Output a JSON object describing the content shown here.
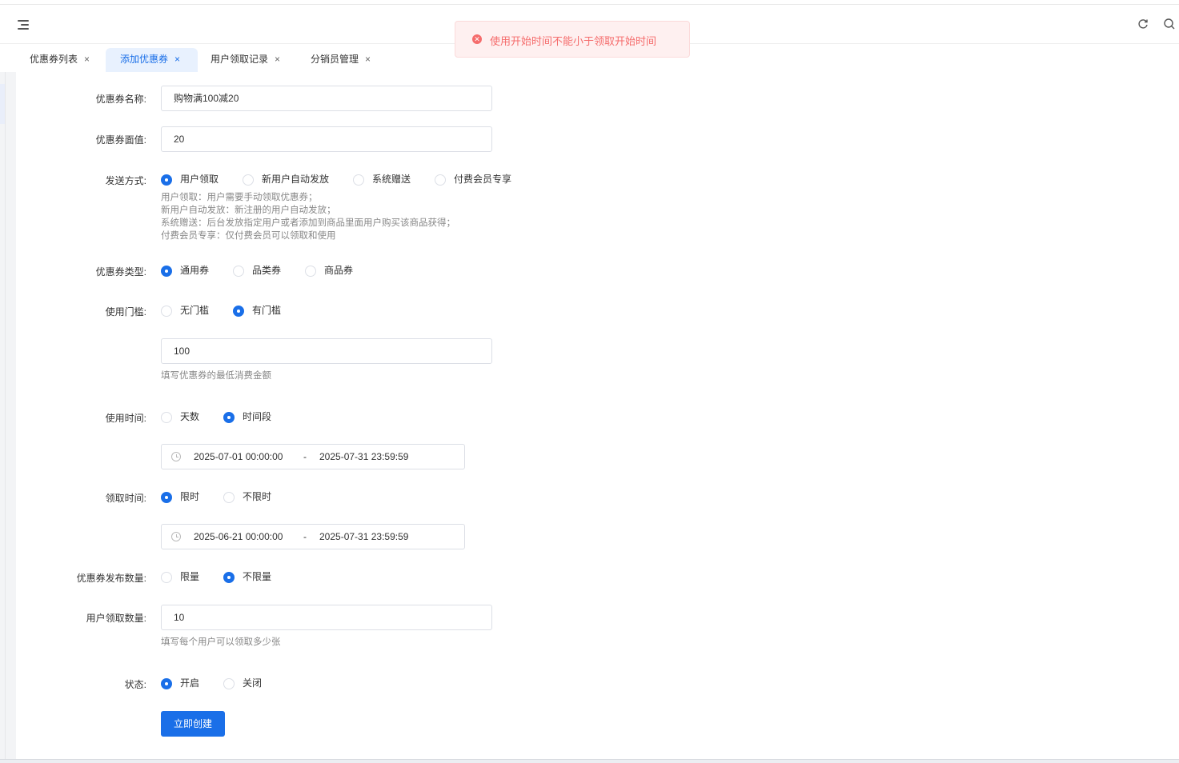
{
  "toast": {
    "message": "使用开始时间不能小于领取开始时间"
  },
  "tabs": [
    {
      "label": "优惠券列表"
    },
    {
      "label": "添加优惠券"
    },
    {
      "label": "用户领取记录"
    },
    {
      "label": "分销员管理"
    }
  ],
  "tab_close": "×",
  "form": {
    "name": {
      "label": "优惠券名称:",
      "value": "购物满100减20"
    },
    "value": {
      "label": "优惠券面值:",
      "value": "20"
    },
    "send": {
      "label": "发送方式:",
      "options": [
        "用户领取",
        "新用户自动发放",
        "系统赠送",
        "付费会员专享"
      ],
      "selected": "用户领取",
      "hints": [
        "用户领取：用户需要手动领取优惠券；",
        "新用户自动发放：新注册的用户自动发放；",
        "系统赠送：后台发放指定用户或者添加到商品里面用户购买该商品获得；",
        "付费会员专享：仅付费会员可以领取和使用"
      ]
    },
    "type": {
      "label": "优惠券类型:",
      "options": [
        "通用券",
        "品类券",
        "商品券"
      ],
      "selected": "通用券"
    },
    "threshold": {
      "label": "使用门槛:",
      "options": [
        "无门槛",
        "有门槛"
      ],
      "selected": "有门槛",
      "value": "100",
      "hint": "填写优惠券的最低消费金额"
    },
    "use_time": {
      "label": "使用时间:",
      "options": [
        "天数",
        "时间段"
      ],
      "selected": "时间段",
      "start": "2025-07-01 00:00:00",
      "sep": "-",
      "end": "2025-07-31 23:59:59"
    },
    "receive_time": {
      "label": "领取时间:",
      "options": [
        "限时",
        "不限时"
      ],
      "selected": "限时",
      "start": "2025-06-21 00:00:00",
      "sep": "-",
      "end": "2025-07-31 23:59:59"
    },
    "issue": {
      "label": "优惠券发布数量:",
      "options": [
        "限量",
        "不限量"
      ],
      "selected": "不限量"
    },
    "per_user": {
      "label": "用户领取数量:",
      "value": "10",
      "hint": "填写每个用户可以领取多少张"
    },
    "status": {
      "label": "状态:",
      "options": [
        "开启",
        "关闭"
      ],
      "selected": "开启"
    },
    "submit": "立即创建"
  },
  "colors": {
    "primary": "#1a6fe8",
    "error": "#f56c6c",
    "toast_bg": "#fef0f0"
  }
}
